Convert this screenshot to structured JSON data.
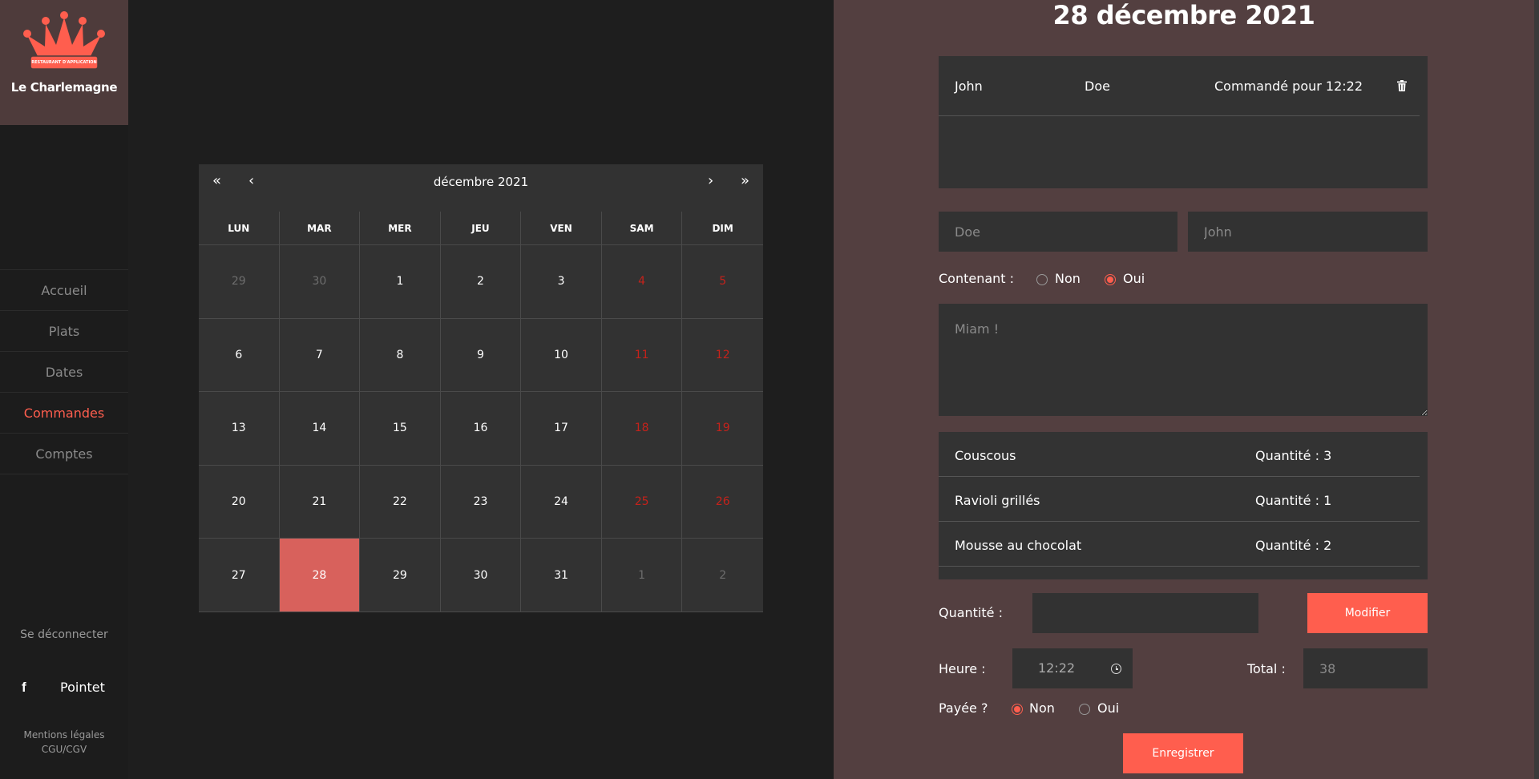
{
  "sidebar": {
    "brand_name": "Le Charlemagne",
    "logo_ribbon": "RESTAURANT D'APPLICATION",
    "nav": [
      {
        "label": "Accueil",
        "active": false
      },
      {
        "label": "Plats",
        "active": false
      },
      {
        "label": "Dates",
        "active": false
      },
      {
        "label": "Commandes",
        "active": true
      },
      {
        "label": "Comptes",
        "active": false
      }
    ],
    "logout": "Se déconnecter",
    "facebook_icon": "facebook-icon",
    "facebook_label": "Pointet",
    "legal_1": "Mentions légales",
    "legal_2": "CGU/CGV"
  },
  "calendar": {
    "title": "décembre 2021",
    "nav": {
      "prev_year": "«",
      "prev_month": "‹",
      "next_month": "›",
      "next_year": "»"
    },
    "weekdays": [
      "LUN",
      "MAR",
      "MER",
      "JEU",
      "VEN",
      "SAM",
      "DIM"
    ],
    "days": [
      {
        "label": "29",
        "type": "other"
      },
      {
        "label": "30",
        "type": "other"
      },
      {
        "label": "1",
        "type": "normal"
      },
      {
        "label": "2",
        "type": "normal"
      },
      {
        "label": "3",
        "type": "normal"
      },
      {
        "label": "4",
        "type": "weekend"
      },
      {
        "label": "5",
        "type": "weekend"
      },
      {
        "label": "6",
        "type": "normal"
      },
      {
        "label": "7",
        "type": "normal"
      },
      {
        "label": "8",
        "type": "normal"
      },
      {
        "label": "9",
        "type": "normal"
      },
      {
        "label": "10",
        "type": "normal"
      },
      {
        "label": "11",
        "type": "weekend"
      },
      {
        "label": "12",
        "type": "weekend"
      },
      {
        "label": "13",
        "type": "normal"
      },
      {
        "label": "14",
        "type": "normal"
      },
      {
        "label": "15",
        "type": "normal"
      },
      {
        "label": "16",
        "type": "normal"
      },
      {
        "label": "17",
        "type": "normal"
      },
      {
        "label": "18",
        "type": "weekend"
      },
      {
        "label": "19",
        "type": "weekend"
      },
      {
        "label": "20",
        "type": "normal"
      },
      {
        "label": "21",
        "type": "normal"
      },
      {
        "label": "22",
        "type": "normal"
      },
      {
        "label": "23",
        "type": "normal"
      },
      {
        "label": "24",
        "type": "normal"
      },
      {
        "label": "25",
        "type": "weekend"
      },
      {
        "label": "26",
        "type": "weekend"
      },
      {
        "label": "27",
        "type": "normal"
      },
      {
        "label": "28",
        "type": "selected"
      },
      {
        "label": "29",
        "type": "normal"
      },
      {
        "label": "30",
        "type": "normal"
      },
      {
        "label": "31",
        "type": "normal"
      },
      {
        "label": "1",
        "type": "other"
      },
      {
        "label": "2",
        "type": "other"
      }
    ]
  },
  "panel": {
    "title": "28 décembre 2021",
    "order": {
      "first_name": "John",
      "last_name": "Doe",
      "ordered_for": "Commandé pour 12:22"
    },
    "lastname_placeholder": "Doe",
    "firstname_placeholder": "John",
    "container_label": "Contenant :",
    "container_no": "Non",
    "container_yes": "Oui",
    "container_value": "Oui",
    "comment_placeholder": "Miam !",
    "items": [
      {
        "name": "Couscous",
        "qty": "Quantité : 3"
      },
      {
        "name": "Ravioli grillés",
        "qty": "Quantité : 1"
      },
      {
        "name": "Mousse au chocolat",
        "qty": "Quantité : 2"
      }
    ],
    "quantity_label": "Quantité :",
    "quantity_value": "",
    "modify_button": "Modifier",
    "time_label": "Heure :",
    "time_value": "12:22",
    "total_label": "Total :",
    "total_value": "38",
    "paid_label": "Payée ?",
    "paid_no": "Non",
    "paid_yes": "Oui",
    "paid_value": "Non",
    "save_button": "Enregistrer"
  },
  "colors": {
    "accent": "#ff5e4e",
    "panel_bg": "#533f40",
    "selected_day": "#d8615c",
    "weekend_text": "#c4221b"
  }
}
